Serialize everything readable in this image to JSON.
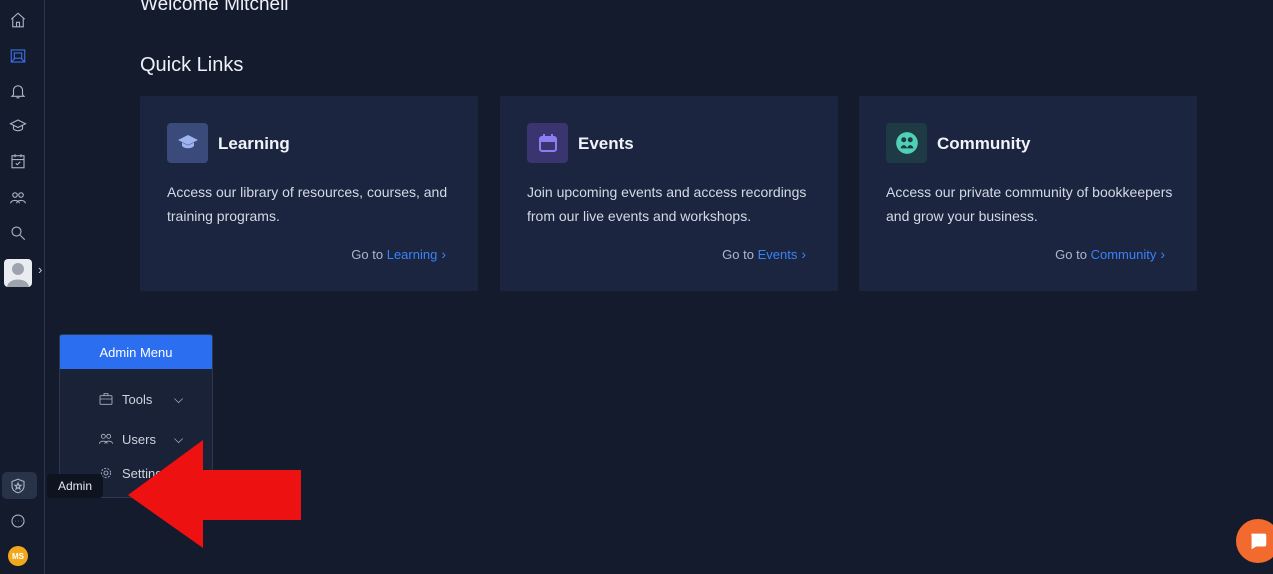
{
  "header": {
    "welcome": "Welcome Mitchell",
    "quick_links_title": "Quick Links"
  },
  "cards": [
    {
      "title": "Learning",
      "description": "Access our library of resources, courses, and training programs.",
      "link_prefix": "Go to",
      "link_target": "Learning",
      "icon": "graduation-cap-icon",
      "icon_color": "#3a4a7a"
    },
    {
      "title": "Events",
      "description": "Join upcoming events and access recordings from our live events and workshops.",
      "link_prefix": "Go to",
      "link_target": "Events",
      "icon": "calendar-icon",
      "icon_color": "#3a3470"
    },
    {
      "title": "Community",
      "description": "Access our private community of bookkeepers and grow your business.",
      "link_prefix": "Go to",
      "link_target": "Community",
      "icon": "community-icon",
      "icon_color": "#1e3a44"
    }
  ],
  "admin_menu": {
    "header": "Admin Menu",
    "items": [
      {
        "label": "Tools",
        "icon": "briefcase-icon",
        "expandable": true
      },
      {
        "label": "Users",
        "icon": "users-icon",
        "expandable": true
      },
      {
        "label": "Settings",
        "icon": "gear-icon",
        "expandable": false
      }
    ]
  },
  "tooltip": "Admin",
  "user_initials": "MS",
  "colors": {
    "background": "#141b2d",
    "card": "#1b2540",
    "accent": "#2b6ef0",
    "link": "#3b82f6",
    "chat": "#f26a2d",
    "arrow": "#ee1111"
  }
}
